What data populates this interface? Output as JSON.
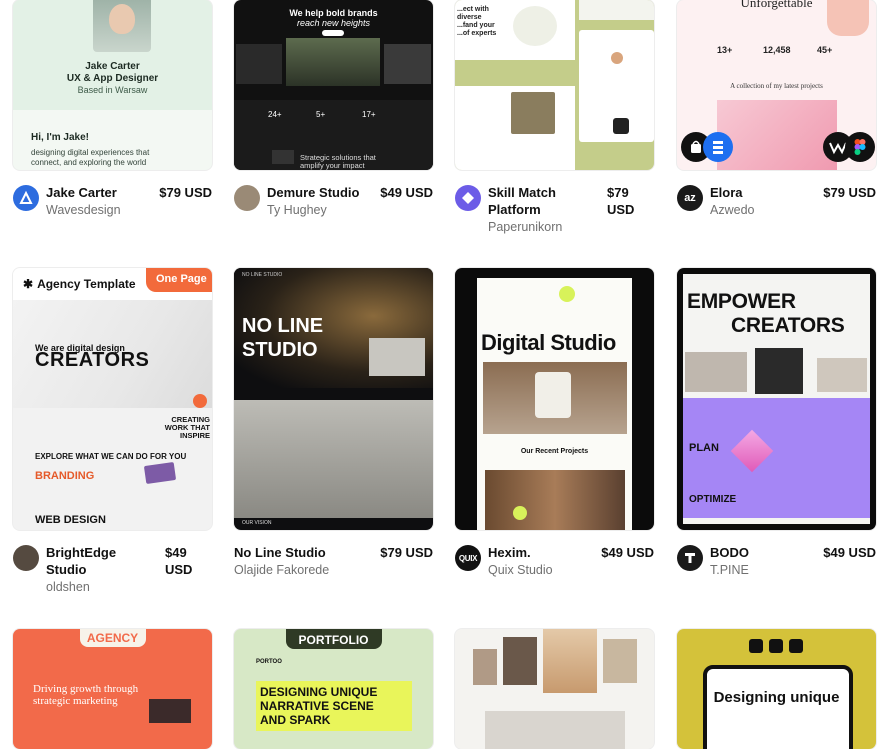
{
  "cards": [
    {
      "title": "Jake Carter",
      "author": "Wavesdesign",
      "price": "$79 USD",
      "thumb": {
        "name_line": "Jake Carter",
        "role_line": "UX & App Designer",
        "loc_line": "Based in Warsaw",
        "hi_line": "Hi, I'm  Jake!",
        "desc_line": "designing digital experiences that connect, and exploring the world"
      }
    },
    {
      "title": "Demure Studio",
      "author": "Ty Hughey",
      "price": "$49 USD",
      "thumb": {
        "headline_a": "We help bold brands",
        "headline_b": "reach new heights",
        "stat_a": "24+",
        "stat_b": "5+",
        "stat_c": "17+",
        "tagline": "Strategic solutions that amplify your impact"
      }
    },
    {
      "title": "Skill Match Platform",
      "author": "Paperunikorn",
      "price": "$79 USD",
      "thumb": {
        "head": "...ect with diverse ...fand your ...of experts"
      }
    },
    {
      "title": "Elora",
      "author": "Azwedo",
      "price": "$79 USD",
      "thumb": {
        "headline": "Unforgettable",
        "stat_a": "13+",
        "stat_b": "12,458",
        "stat_c": "45+",
        "sub": "A collection of my latest projects"
      }
    },
    {
      "title": "BrightEdge Studio",
      "author": "oldshen",
      "price": "$49 USD",
      "thumb": {
        "badge_a": "Agency Template",
        "badge_b": "One Page",
        "intro": "We are digital design",
        "big": "CREATORS",
        "work": "CREATING WORK THAT INSPIRE",
        "explore": "EXPLORE WHAT WE CAN DO FOR YOU",
        "branding": "BRANDING",
        "webdesign": "WEB DESIGN"
      }
    },
    {
      "title": "No Line Studio",
      "author": "Olajide Fakorede",
      "price": "$79 USD",
      "thumb": {
        "brand": "NO LINE STUDIO",
        "headline": "NO LINE STUDIO",
        "footer_a": "OUR VISION"
      }
    },
    {
      "title": "Hexim.",
      "author": "Quix Studio",
      "price": "$49 USD",
      "thumb": {
        "headline": "Digital Studio",
        "projects": "Our Recent Projects"
      }
    },
    {
      "title": "BODO",
      "author": "T.PINE",
      "price": "$49 USD",
      "thumb": {
        "headline_a": "EMPOWER",
        "headline_b": "CREATORS",
        "plan": "PLAN",
        "optimize": "OPTIMIZE"
      }
    },
    {
      "title": "",
      "author": "",
      "price": "",
      "thumb": {
        "badge": "AGENCY",
        "headline": "Driving growth through strategic marketing"
      }
    },
    {
      "title": "",
      "author": "",
      "price": "",
      "thumb": {
        "badge": "PORTFOLIO",
        "brand": "PORTOO",
        "headline_a": "DESIGNING UNIQUE",
        "headline_b": "NARRATIVE SCENE",
        "headline_c": "AND SPARK"
      }
    },
    {
      "title": "",
      "author": "",
      "price": "",
      "thumb": {}
    },
    {
      "title": "",
      "author": "",
      "price": "",
      "thumb": {
        "headline": "Designing unique"
      }
    }
  ],
  "colors": {
    "price": "#111111",
    "author": "#707070",
    "accent_orange": "#f26a3b",
    "accent_purple": "#a586f5",
    "accent_lime": "#d8f25a"
  }
}
